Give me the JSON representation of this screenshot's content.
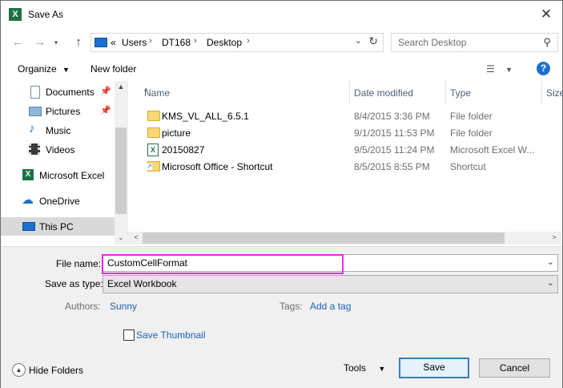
{
  "window": {
    "title": "Save As",
    "icon": "excel-icon"
  },
  "nav": {
    "back": "←",
    "forward": "→",
    "up": "↑",
    "breadcrumb": {
      "overflow": "«",
      "items": [
        "Users",
        "DT168",
        "Desktop"
      ]
    },
    "search_placeholder": "Search Desktop"
  },
  "toolbar": {
    "organize": "Organize",
    "new_folder": "New folder"
  },
  "sidebar": {
    "items": [
      {
        "label": "Documents",
        "icon": "documents-icon",
        "pinned": true
      },
      {
        "label": "Pictures",
        "icon": "pictures-icon",
        "pinned": true
      },
      {
        "label": "Music",
        "icon": "music-icon"
      },
      {
        "label": "Videos",
        "icon": "videos-icon"
      },
      {
        "label": "Microsoft Excel",
        "icon": "excel-icon"
      },
      {
        "label": "OneDrive",
        "icon": "onedrive-icon"
      },
      {
        "label": "This PC",
        "icon": "computer-icon",
        "selected": true
      }
    ]
  },
  "columns": {
    "name": "Name",
    "date": "Date modified",
    "type": "Type",
    "size": "Size"
  },
  "files": [
    {
      "name": "KMS_VL_ALL_6.5.1",
      "date": "8/4/2015 3:36 PM",
      "type": "File folder",
      "icon": "folder-icon"
    },
    {
      "name": "picture",
      "date": "9/1/2015 11:53 PM",
      "type": "File folder",
      "icon": "folder-icon"
    },
    {
      "name": "20150827",
      "date": "9/5/2015 11:24 PM",
      "type": "Microsoft Excel W...",
      "icon": "excel-file-icon"
    },
    {
      "name": "Microsoft Office - Shortcut",
      "date": "8/5/2015 8:55 PM",
      "type": "Shortcut",
      "icon": "shortcut-icon"
    }
  ],
  "form": {
    "file_name_label": "File name:",
    "file_name_value": "CustomCellFormat",
    "save_type_label": "Save as type:",
    "save_type_value": "Excel Workbook",
    "authors_label": "Authors:",
    "authors_value": "Sunny",
    "tags_label": "Tags:",
    "tags_value": "Add a tag",
    "thumbnail_label": "Save Thumbnail",
    "thumbnail_checked": false
  },
  "footer": {
    "hide_folders": "Hide Folders",
    "tools": "Tools",
    "save": "Save",
    "cancel": "Cancel"
  },
  "colors": {
    "highlight": "#e629e6",
    "link": "#1c63b7",
    "excel": "#1e7145"
  }
}
